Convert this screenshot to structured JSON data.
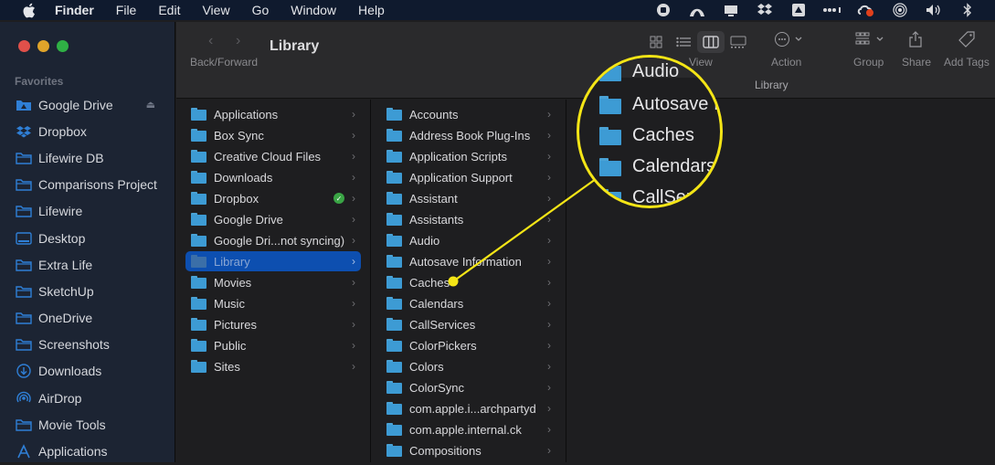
{
  "menubar": {
    "app_name": "Finder",
    "items": [
      "File",
      "Edit",
      "View",
      "Go",
      "Window",
      "Help"
    ],
    "status_icons": [
      "screen-record-icon",
      "vpn-icon",
      "display-icon",
      "dropbox-icon",
      "google-drive-icon",
      "more-dots-icon",
      "creative-cloud-icon",
      "airdrop-wireless-icon",
      "volume-icon",
      "bluetooth-icon"
    ]
  },
  "window": {
    "title": "Library",
    "path_title": "Library",
    "toolbar": {
      "back_forward_label": "Back/Forward",
      "view_label": "View",
      "action_label": "Action",
      "group_label": "Group",
      "share_label": "Share",
      "add_tags_label": "Add Tags",
      "active_view": "columns"
    }
  },
  "sidebar": {
    "section_label": "Favorites",
    "items": [
      {
        "label": "Google Drive",
        "icon": "google-drive-folder-icon",
        "eject": true
      },
      {
        "label": "Dropbox",
        "icon": "dropbox-icon"
      },
      {
        "label": "Lifewire DB",
        "icon": "folder-icon"
      },
      {
        "label": "Comparisons Project",
        "icon": "folder-icon"
      },
      {
        "label": "Lifewire",
        "icon": "folder-icon"
      },
      {
        "label": "Desktop",
        "icon": "desktop-icon"
      },
      {
        "label": "Extra Life",
        "icon": "folder-icon"
      },
      {
        "label": "SketchUp",
        "icon": "folder-icon"
      },
      {
        "label": "OneDrive",
        "icon": "folder-icon"
      },
      {
        "label": "Screenshots",
        "icon": "folder-icon"
      },
      {
        "label": "Downloads",
        "icon": "downloads-icon"
      },
      {
        "label": "AirDrop",
        "icon": "airdrop-icon"
      },
      {
        "label": "Movie Tools",
        "icon": "folder-icon"
      },
      {
        "label": "Applications",
        "icon": "applications-icon"
      }
    ]
  },
  "column1": {
    "selected": "Library",
    "items": [
      "Applications",
      "Box Sync",
      "Creative Cloud Files",
      "Downloads",
      "Dropbox",
      "Google Drive",
      "Google Dri...not syncing)",
      "Library",
      "Movies",
      "Music",
      "Pictures",
      "Public",
      "Sites"
    ],
    "synced_badge_item": "Dropbox"
  },
  "column2": {
    "items": [
      "Accounts",
      "Address Book Plug-Ins",
      "Application Scripts",
      "Application Support",
      "Assistant",
      "Assistants",
      "Audio",
      "Autosave Information",
      "Caches",
      "Calendars",
      "CallServices",
      "ColorPickers",
      "Colors",
      "ColorSync",
      "com.apple.i...archpartyd",
      "com.apple.internal.ck",
      "Compositions"
    ]
  },
  "callout": {
    "target_item": "Caches",
    "magnified_items": [
      "Audio",
      "Autosave I",
      "Caches",
      "Calendars",
      "CallSer"
    ],
    "color": "#f4e516"
  },
  "colors": {
    "selection": "#0d4fb0",
    "folder": "#3d9bd4",
    "sidebar_icon": "#2f7fd6",
    "callout": "#f4e516"
  }
}
